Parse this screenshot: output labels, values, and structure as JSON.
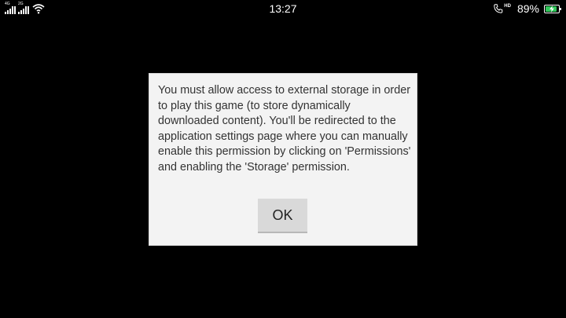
{
  "status_bar": {
    "time": "13:27",
    "battery_percent": "89%",
    "battery_level": 0.89,
    "battery_charging": true,
    "net_tag_1": "4G",
    "net_tag_2": "2G",
    "hd_label": "HD",
    "icons": [
      "signal-icon",
      "signal-icon",
      "wifi-icon",
      "call-icon",
      "battery-icon"
    ],
    "colors": {
      "battery_fill": "#31c75a",
      "foreground": "#ffffff"
    }
  },
  "dialog": {
    "message": "You must allow access to external storage in order to play this game (to store dynamically downloaded content). You'll be redirected to the application settings page where you can manually enable this permission by clicking on 'Permissions' and enabling the 'Storage' permission.",
    "ok_label": "OK",
    "colors": {
      "background": "#f3f3f3",
      "button": "#d9d9d9"
    }
  },
  "screen": {
    "background": "#000000"
  }
}
